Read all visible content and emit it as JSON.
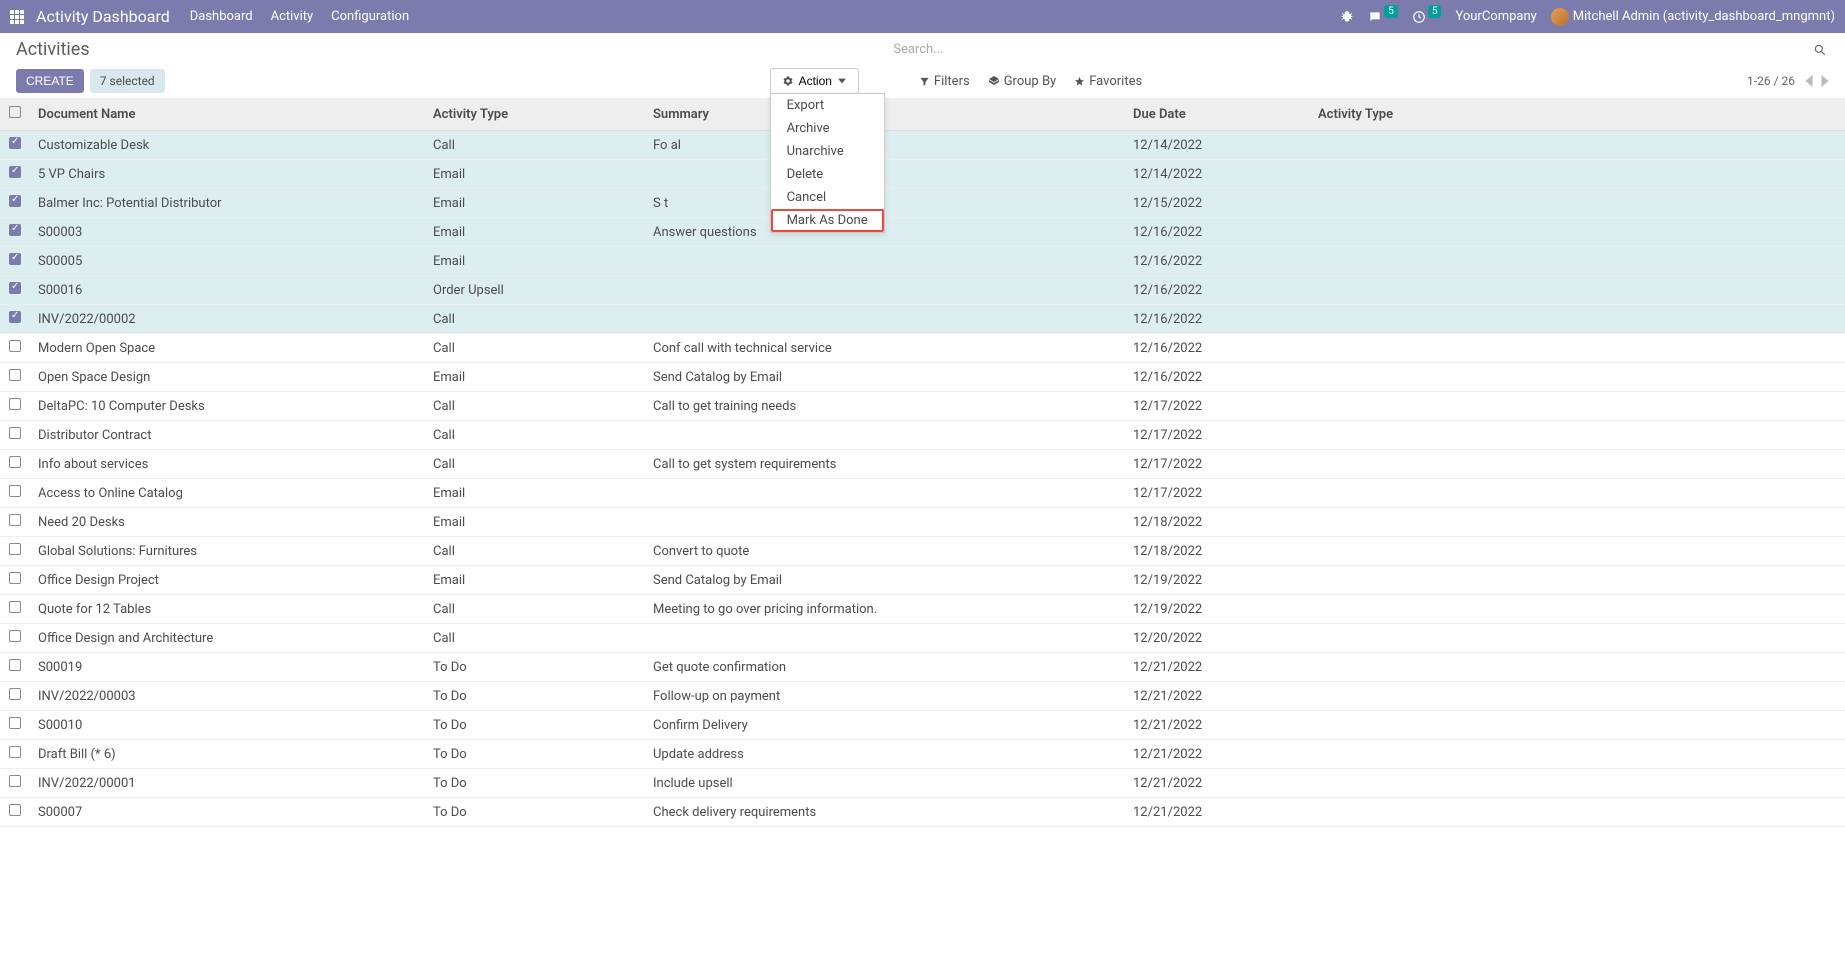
{
  "navbar": {
    "app_title": "Activity Dashboard",
    "menu": [
      "Dashboard",
      "Activity",
      "Configuration"
    ],
    "chat_badge": "5",
    "clock_badge": "5",
    "company": "YourCompany",
    "user": "Mitchell Admin (activity_dashboard_mngmnt)"
  },
  "control": {
    "breadcrumb": "Activities",
    "search_placeholder": "Search...",
    "create_label": "CREATE",
    "selected_label": "7 selected",
    "action_label": "Action",
    "filters_label": "Filters",
    "groupby_label": "Group By",
    "favorites_label": "Favorites",
    "pager": "1-26 / 26"
  },
  "action_menu": [
    "Export",
    "Archive",
    "Unarchive",
    "Delete",
    "Cancel",
    "Mark As Done"
  ],
  "action_menu_highlighted_index": 5,
  "columns": [
    "",
    "Document Name",
    "Activity Type",
    "Summary",
    "Due Date",
    "Activity Type"
  ],
  "rows": [
    {
      "c": true,
      "doc": "Customizable Desk",
      "type": "Call",
      "summary": "Fo                                   al",
      "due": "12/14/2022"
    },
    {
      "c": true,
      "doc": "5 VP Chairs",
      "type": "Email",
      "summary": "",
      "due": "12/14/2022"
    },
    {
      "c": true,
      "doc": "Balmer Inc: Potential Distributor",
      "type": "Email",
      "summary": "S                                        t",
      "due": "12/15/2022"
    },
    {
      "c": true,
      "doc": "S00003",
      "type": "Email",
      "summary": "Answer questions",
      "due": "12/16/2022"
    },
    {
      "c": true,
      "doc": "S00005",
      "type": "Email",
      "summary": "",
      "due": "12/16/2022"
    },
    {
      "c": true,
      "doc": "S00016",
      "type": "Order Upsell",
      "summary": "",
      "due": "12/16/2022"
    },
    {
      "c": true,
      "doc": "INV/2022/00002",
      "type": "Call",
      "summary": "",
      "due": "12/16/2022"
    },
    {
      "c": false,
      "doc": "Modern Open Space",
      "type": "Call",
      "summary": "Conf call with technical service",
      "due": "12/16/2022"
    },
    {
      "c": false,
      "doc": "Open Space Design",
      "type": "Email",
      "summary": "Send Catalog by Email",
      "due": "12/16/2022"
    },
    {
      "c": false,
      "doc": "DeltaPC: 10 Computer Desks",
      "type": "Call",
      "summary": "Call to get training needs",
      "due": "12/17/2022"
    },
    {
      "c": false,
      "doc": "Distributor Contract",
      "type": "Call",
      "summary": "",
      "due": "12/17/2022"
    },
    {
      "c": false,
      "doc": "Info about services",
      "type": "Call",
      "summary": "Call to get system requirements",
      "due": "12/17/2022"
    },
    {
      "c": false,
      "doc": "Access to Online Catalog",
      "type": "Email",
      "summary": "",
      "due": "12/17/2022"
    },
    {
      "c": false,
      "doc": "Need 20 Desks",
      "type": "Email",
      "summary": "",
      "due": "12/18/2022"
    },
    {
      "c": false,
      "doc": "Global Solutions: Furnitures",
      "type": "Call",
      "summary": "Convert to quote",
      "due": "12/18/2022"
    },
    {
      "c": false,
      "doc": "Office Design Project",
      "type": "Email",
      "summary": "Send Catalog by Email",
      "due": "12/19/2022"
    },
    {
      "c": false,
      "doc": "Quote for 12 Tables",
      "type": "Call",
      "summary": "Meeting to go over pricing information.",
      "due": "12/19/2022"
    },
    {
      "c": false,
      "doc": "Office Design and Architecture",
      "type": "Call",
      "summary": "",
      "due": "12/20/2022"
    },
    {
      "c": false,
      "doc": "S00019",
      "type": "To Do",
      "summary": "Get quote confirmation",
      "due": "12/21/2022"
    },
    {
      "c": false,
      "doc": "INV/2022/00003",
      "type": "To Do",
      "summary": "Follow-up on payment",
      "due": "12/21/2022"
    },
    {
      "c": false,
      "doc": "S00010",
      "type": "To Do",
      "summary": "Confirm Delivery",
      "due": "12/21/2022"
    },
    {
      "c": false,
      "doc": "Draft Bill (* 6)",
      "type": "To Do",
      "summary": "Update address",
      "due": "12/21/2022"
    },
    {
      "c": false,
      "doc": "INV/2022/00001",
      "type": "To Do",
      "summary": "Include upsell",
      "due": "12/21/2022"
    },
    {
      "c": false,
      "doc": "S00007",
      "type": "To Do",
      "summary": "Check delivery requirements",
      "due": "12/21/2022"
    }
  ]
}
